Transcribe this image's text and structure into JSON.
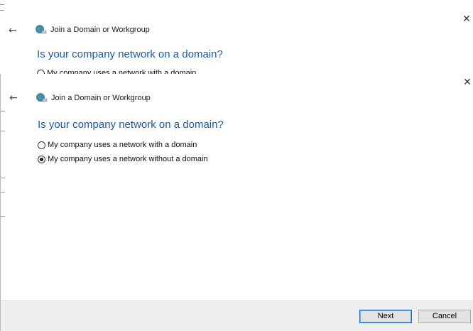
{
  "background_window": {
    "title": "Join a Domain or Workgroup",
    "heading": "Is your company network on a domain?",
    "partial_option": "My company uses a network with a domain"
  },
  "window": {
    "title": "Join a Domain or Workgroup",
    "heading": "Is your company network on a domain?",
    "options": [
      {
        "label": "My company uses a network with a domain",
        "selected": false
      },
      {
        "label": "My company uses a network without a domain",
        "selected": true
      }
    ],
    "next_label": "Next",
    "cancel_label": "Cancel"
  },
  "icons": {
    "close": "close-icon",
    "back": "back-arrow-icon",
    "title": "network-globe-icon"
  },
  "colors": {
    "heading": "#1e5aa0",
    "primary_button_border": "#1d6fc8",
    "footer_bg": "#efefef"
  }
}
